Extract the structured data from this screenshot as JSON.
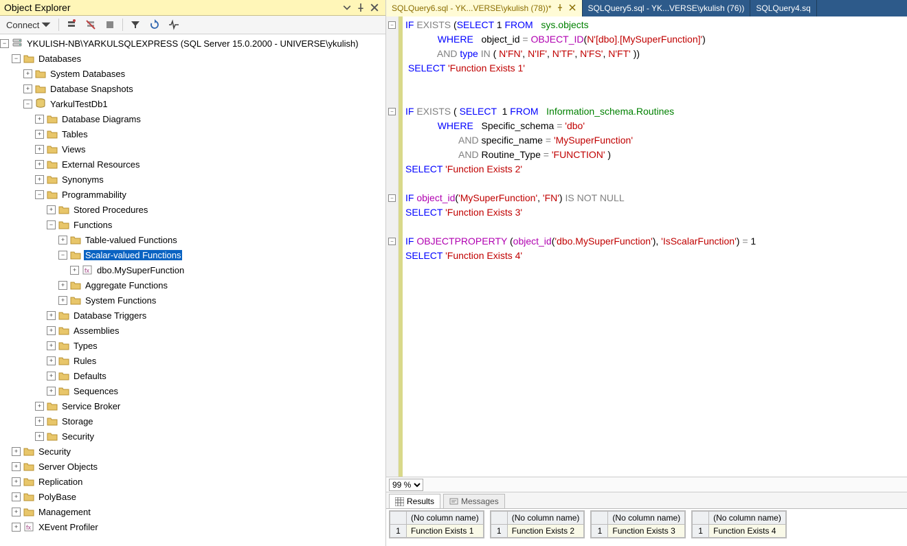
{
  "explorer": {
    "title": "Object Explorer",
    "connect_label": "Connect",
    "nodes": [
      {
        "depth": 0,
        "exp": "−",
        "icon": "srv",
        "label": "YKULISH-NB\\YARKULSQLEXPRESS (SQL Server 15.0.2000 - UNIVERSE\\ykulish)"
      },
      {
        "depth": 1,
        "exp": "−",
        "icon": "folder",
        "label": "Databases"
      },
      {
        "depth": 2,
        "exp": "+",
        "icon": "folder",
        "label": "System Databases"
      },
      {
        "depth": 2,
        "exp": "+",
        "icon": "folder",
        "label": "Database Snapshots"
      },
      {
        "depth": 2,
        "exp": "−",
        "icon": "db",
        "label": "YarkulTestDb1"
      },
      {
        "depth": 3,
        "exp": "+",
        "icon": "folder",
        "label": "Database Diagrams"
      },
      {
        "depth": 3,
        "exp": "+",
        "icon": "folder",
        "label": "Tables"
      },
      {
        "depth": 3,
        "exp": "+",
        "icon": "folder",
        "label": "Views"
      },
      {
        "depth": 3,
        "exp": "+",
        "icon": "folder",
        "label": "External Resources"
      },
      {
        "depth": 3,
        "exp": "+",
        "icon": "folder",
        "label": "Synonyms"
      },
      {
        "depth": 3,
        "exp": "−",
        "icon": "folder",
        "label": "Programmability"
      },
      {
        "depth": 4,
        "exp": "+",
        "icon": "folder",
        "label": "Stored Procedures"
      },
      {
        "depth": 4,
        "exp": "−",
        "icon": "folder",
        "label": "Functions"
      },
      {
        "depth": 5,
        "exp": "+",
        "icon": "folder",
        "label": "Table-valued Functions"
      },
      {
        "depth": 5,
        "exp": "−",
        "icon": "folder",
        "label": "Scalar-valued Functions",
        "selected": true
      },
      {
        "depth": 6,
        "exp": "+",
        "icon": "fn",
        "label": "dbo.MySuperFunction"
      },
      {
        "depth": 5,
        "exp": "+",
        "icon": "folder",
        "label": "Aggregate Functions"
      },
      {
        "depth": 5,
        "exp": "+",
        "icon": "folder",
        "label": "System Functions"
      },
      {
        "depth": 4,
        "exp": "+",
        "icon": "folder",
        "label": "Database Triggers"
      },
      {
        "depth": 4,
        "exp": "+",
        "icon": "folder",
        "label": "Assemblies"
      },
      {
        "depth": 4,
        "exp": "+",
        "icon": "folder",
        "label": "Types"
      },
      {
        "depth": 4,
        "exp": "+",
        "icon": "folder",
        "label": "Rules"
      },
      {
        "depth": 4,
        "exp": "+",
        "icon": "folder",
        "label": "Defaults"
      },
      {
        "depth": 4,
        "exp": "+",
        "icon": "folder",
        "label": "Sequences"
      },
      {
        "depth": 3,
        "exp": "+",
        "icon": "folder",
        "label": "Service Broker"
      },
      {
        "depth": 3,
        "exp": "+",
        "icon": "folder",
        "label": "Storage"
      },
      {
        "depth": 3,
        "exp": "+",
        "icon": "folder",
        "label": "Security"
      },
      {
        "depth": 1,
        "exp": "+",
        "icon": "folder",
        "label": "Security"
      },
      {
        "depth": 1,
        "exp": "+",
        "icon": "folder",
        "label": "Server Objects"
      },
      {
        "depth": 1,
        "exp": "+",
        "icon": "folder",
        "label": "Replication"
      },
      {
        "depth": 1,
        "exp": "+",
        "icon": "folder",
        "label": "PolyBase"
      },
      {
        "depth": 1,
        "exp": "+",
        "icon": "folder",
        "label": "Management"
      },
      {
        "depth": 1,
        "exp": "+",
        "icon": "fn",
        "label": "XEvent Profiler"
      }
    ]
  },
  "tabs": [
    {
      "label": "SQLQuery6.sql - YK...VERSE\\ykulish (78))*",
      "active": true,
      "pinned": true,
      "close": true
    },
    {
      "label": "SQLQuery5.sql - YK...VERSE\\ykulish (76))",
      "active": false
    },
    {
      "label": "SQLQuery4.sq",
      "active": false
    }
  ],
  "code_lines": [
    [
      {
        "t": "IF",
        "c": "k-blue"
      },
      {
        "t": " "
      },
      {
        "t": "EXISTS",
        "c": "k-gray"
      },
      {
        "t": " ("
      },
      {
        "t": "SELECT",
        "c": "k-blue"
      },
      {
        "t": " 1 "
      },
      {
        "t": "FROM",
        "c": "k-blue"
      },
      {
        "t": "   "
      },
      {
        "t": "sys.objects",
        "c": "k-green"
      }
    ],
    [
      {
        "t": "            "
      },
      {
        "t": "WHERE",
        "c": "k-blue"
      },
      {
        "t": "   "
      },
      {
        "t": "object_id",
        "c": ""
      },
      {
        "t": " "
      },
      {
        "t": "=",
        "c": "k-gray"
      },
      {
        "t": " "
      },
      {
        "t": "OBJECT_ID",
        "c": "k-magenta"
      },
      {
        "t": "("
      },
      {
        "t": "N'[dbo].[MySuperFunction]'",
        "c": "k-red"
      },
      {
        "t": ")"
      }
    ],
    [
      {
        "t": "            "
      },
      {
        "t": "AND",
        "c": "k-gray"
      },
      {
        "t": " "
      },
      {
        "t": "type",
        "c": "k-blue"
      },
      {
        "t": " "
      },
      {
        "t": "IN",
        "c": "k-gray"
      },
      {
        "t": " ( "
      },
      {
        "t": "N'FN'",
        "c": "k-red"
      },
      {
        "t": ", "
      },
      {
        "t": "N'IF'",
        "c": "k-red"
      },
      {
        "t": ", "
      },
      {
        "t": "N'TF'",
        "c": "k-red"
      },
      {
        "t": ", "
      },
      {
        "t": "N'FS'",
        "c": "k-red"
      },
      {
        "t": ", "
      },
      {
        "t": "N'FT'",
        "c": "k-red"
      },
      {
        "t": " ))"
      }
    ],
    [
      {
        "t": " "
      },
      {
        "t": "SELECT",
        "c": "k-blue"
      },
      {
        "t": " "
      },
      {
        "t": "'Function Exists 1'",
        "c": "k-red"
      }
    ],
    [
      {
        "t": " "
      }
    ],
    [
      {
        "t": " "
      }
    ],
    [
      {
        "t": "IF",
        "c": "k-blue"
      },
      {
        "t": " "
      },
      {
        "t": "EXISTS",
        "c": "k-gray"
      },
      {
        "t": " ( "
      },
      {
        "t": "SELECT",
        "c": "k-blue"
      },
      {
        "t": "  1 "
      },
      {
        "t": "FROM",
        "c": "k-blue"
      },
      {
        "t": "   "
      },
      {
        "t": "Information_schema.Routines",
        "c": "k-green"
      }
    ],
    [
      {
        "t": "            "
      },
      {
        "t": "WHERE",
        "c": "k-blue"
      },
      {
        "t": "   Specific_schema "
      },
      {
        "t": "=",
        "c": "k-gray"
      },
      {
        "t": " "
      },
      {
        "t": "'dbo'",
        "c": "k-red"
      }
    ],
    [
      {
        "t": "                    "
      },
      {
        "t": "AND",
        "c": "k-gray"
      },
      {
        "t": " specific_name "
      },
      {
        "t": "=",
        "c": "k-gray"
      },
      {
        "t": " "
      },
      {
        "t": "'MySuperFunction'",
        "c": "k-red"
      }
    ],
    [
      {
        "t": "                    "
      },
      {
        "t": "AND",
        "c": "k-gray"
      },
      {
        "t": " Routine_Type "
      },
      {
        "t": "=",
        "c": "k-gray"
      },
      {
        "t": " "
      },
      {
        "t": "'FUNCTION'",
        "c": "k-red"
      },
      {
        "t": " )"
      }
    ],
    [
      {
        "t": "SELECT",
        "c": "k-blue"
      },
      {
        "t": " "
      },
      {
        "t": "'Function Exists 2'",
        "c": "k-red"
      }
    ],
    [
      {
        "t": " "
      }
    ],
    [
      {
        "t": "IF",
        "c": "k-blue"
      },
      {
        "t": " "
      },
      {
        "t": "object_id",
        "c": "k-magenta"
      },
      {
        "t": "("
      },
      {
        "t": "'MySuperFunction'",
        "c": "k-red"
      },
      {
        "t": ", "
      },
      {
        "t": "'FN'",
        "c": "k-red"
      },
      {
        "t": ") "
      },
      {
        "t": "IS",
        "c": "k-gray"
      },
      {
        "t": " "
      },
      {
        "t": "NOT",
        "c": "k-gray"
      },
      {
        "t": " "
      },
      {
        "t": "NULL",
        "c": "k-gray"
      }
    ],
    [
      {
        "t": "SELECT",
        "c": "k-blue"
      },
      {
        "t": " "
      },
      {
        "t": "'Function Exists 3'",
        "c": "k-red"
      }
    ],
    [
      {
        "t": " "
      }
    ],
    [
      {
        "t": "IF",
        "c": "k-blue"
      },
      {
        "t": " "
      },
      {
        "t": "OBJECTPROPERTY",
        "c": "k-magenta"
      },
      {
        "t": " ("
      },
      {
        "t": "object_id",
        "c": "k-magenta"
      },
      {
        "t": "("
      },
      {
        "t": "'dbo.MySuperFunction'",
        "c": "k-red"
      },
      {
        "t": "), "
      },
      {
        "t": "'IsScalarFunction'",
        "c": "k-red"
      },
      {
        "t": ") "
      },
      {
        "t": "=",
        "c": "k-gray"
      },
      {
        "t": " 1"
      }
    ],
    [
      {
        "t": "SELECT",
        "c": "k-blue"
      },
      {
        "t": " "
      },
      {
        "t": "'Function Exists 4'",
        "c": "k-red"
      }
    ]
  ],
  "outline_rows": [
    0,
    6,
    12,
    15
  ],
  "zoom": "99 %",
  "result_tabs": {
    "results": "Results",
    "messages": "Messages"
  },
  "results": [
    {
      "header": "(No column name)",
      "row": "1",
      "value": "Function Exists 1"
    },
    {
      "header": "(No column name)",
      "row": "1",
      "value": "Function Exists 2"
    },
    {
      "header": "(No column name)",
      "row": "1",
      "value": "Function Exists 3"
    },
    {
      "header": "(No column name)",
      "row": "1",
      "value": "Function Exists 4"
    }
  ]
}
